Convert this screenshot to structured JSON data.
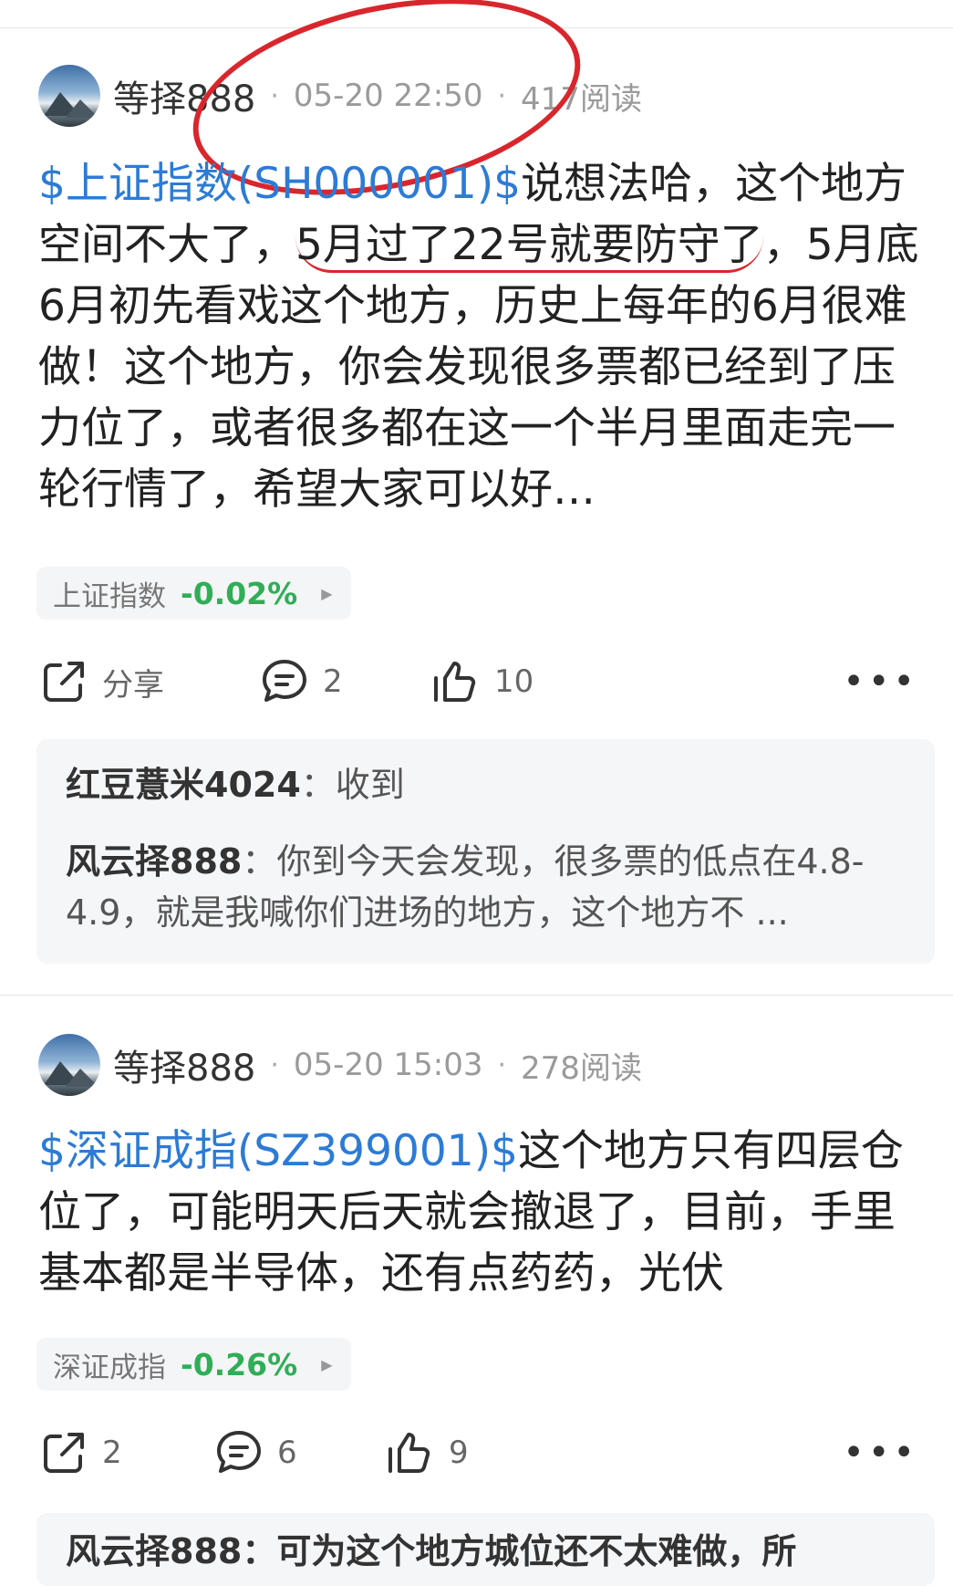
{
  "posts": [
    {
      "author": "等择888",
      "time": "05-20 22:50",
      "reads": "417阅读",
      "tag": "$上证指数(SH000001)$",
      "text_before": "说想法哈，这个地方空间不大了，",
      "text_underlined": "5月过了22号就要防守了",
      "text_after": "，5月底6月初先看戏这个地方，历史上每年的6月很难做！这个地方，你会发现很多票都已经到了压力位了，或者很多都在这一个半月里面走完一轮行情了，希望大家可以好…",
      "stock": {
        "name": "上证指数",
        "change": "-0.02%"
      },
      "share_label": "分享",
      "comment_count": "2",
      "like_count": "10",
      "comments": [
        {
          "name": "红豆薏米4024",
          "sep": "：",
          "text": "收到"
        },
        {
          "name": "风云择888",
          "sep": "：",
          "text": "你到今天会发现，很多票的低点在4.8-4.9，就是我喊你们进场的地方，这个地方不 ..."
        }
      ]
    },
    {
      "author": "等择888",
      "time": "05-20 15:03",
      "reads": "278阅读",
      "tag": "$深证成指(SZ399001)$",
      "text": "这个地方只有四层仓位了，可能明天后天就会撤退了，目前，手里基本都是半导体，还有点药药，光伏",
      "stock": {
        "name": "深证成指",
        "change": "-0.26%"
      },
      "share_count": "2",
      "comment_count": "6",
      "like_count": "9",
      "comment_peek": "风云择888：可为这个地方城位还不太难做，所"
    }
  ],
  "colors": {
    "tag": "#2c7bd6",
    "down": "#2fae56",
    "annotation": "#d9262c"
  }
}
